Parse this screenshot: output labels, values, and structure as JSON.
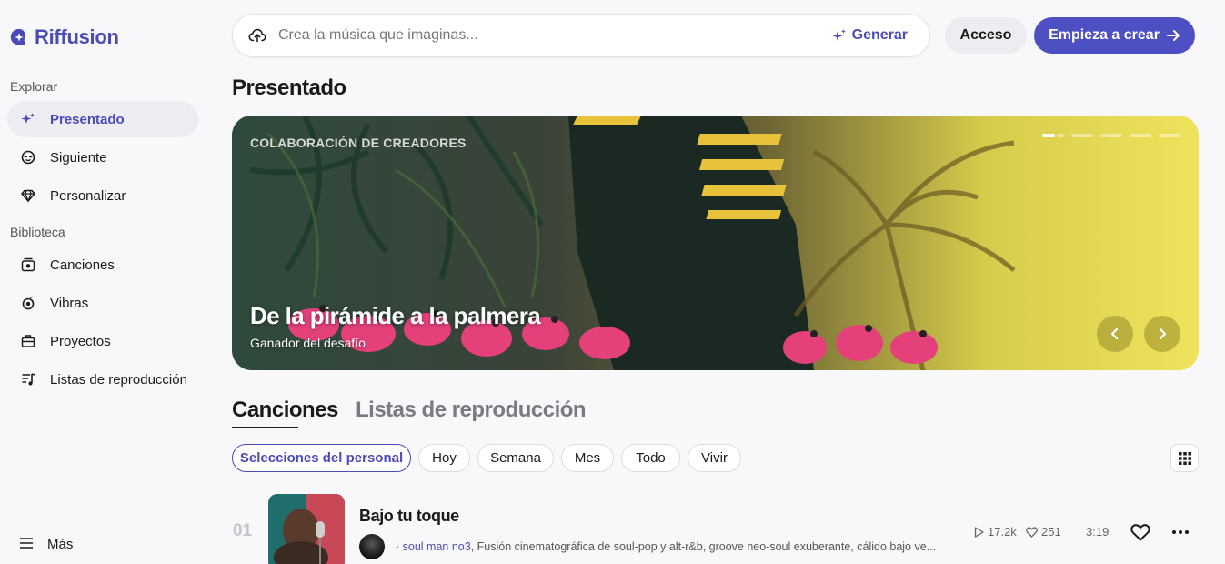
{
  "brand": {
    "name": "Riffusion",
    "accent": "#4b4bb8"
  },
  "sidebar": {
    "explore_label": "Explorar",
    "explore_items": [
      {
        "label": "Presentado",
        "icon": "sparkle-icon",
        "active": true
      },
      {
        "label": "Siguiente",
        "icon": "face-icon"
      },
      {
        "label": "Personalizar",
        "icon": "gem-icon"
      }
    ],
    "library_label": "Biblioteca",
    "library_items": [
      {
        "label": "Canciones",
        "icon": "songs-icon"
      },
      {
        "label": "Vibras",
        "icon": "vibes-icon"
      },
      {
        "label": "Proyectos",
        "icon": "briefcase-icon"
      },
      {
        "label": "Listas de reproducción",
        "icon": "playlist-icon"
      }
    ],
    "more_label": "Más"
  },
  "topbar": {
    "search_placeholder": "Crea la música que imaginas...",
    "generate_label": "Generar",
    "login_label": "Acceso",
    "create_label": "Empieza a crear"
  },
  "main": {
    "title": "Presentado",
    "hero": {
      "kicker": "COLABORACIÓN DE CREADORES",
      "title": "De la pirámide a la palmera",
      "subtitle": "Ganador del desafío",
      "slides": 6,
      "active_slide": 1
    },
    "tabs": [
      {
        "label": "Canciones",
        "active": true
      },
      {
        "label": "Listas de reproducción",
        "active": false
      }
    ],
    "filters": [
      {
        "label": "Selecciones del personal",
        "active": true
      },
      {
        "label": "Hoy"
      },
      {
        "label": "Semana"
      },
      {
        "label": "Mes"
      },
      {
        "label": "Todo"
      },
      {
        "label": "Vivir"
      }
    ],
    "tracks": [
      {
        "rank": "01",
        "title": "Bajo tu toque",
        "author": "soul man no3",
        "description": ", Fusión cinematográfica de soul-pop y alt-r&b, groove neo-soul exuberante, cálido bajo ve...",
        "plays": "17.2k",
        "likes": "251",
        "duration": "3:19"
      }
    ]
  }
}
